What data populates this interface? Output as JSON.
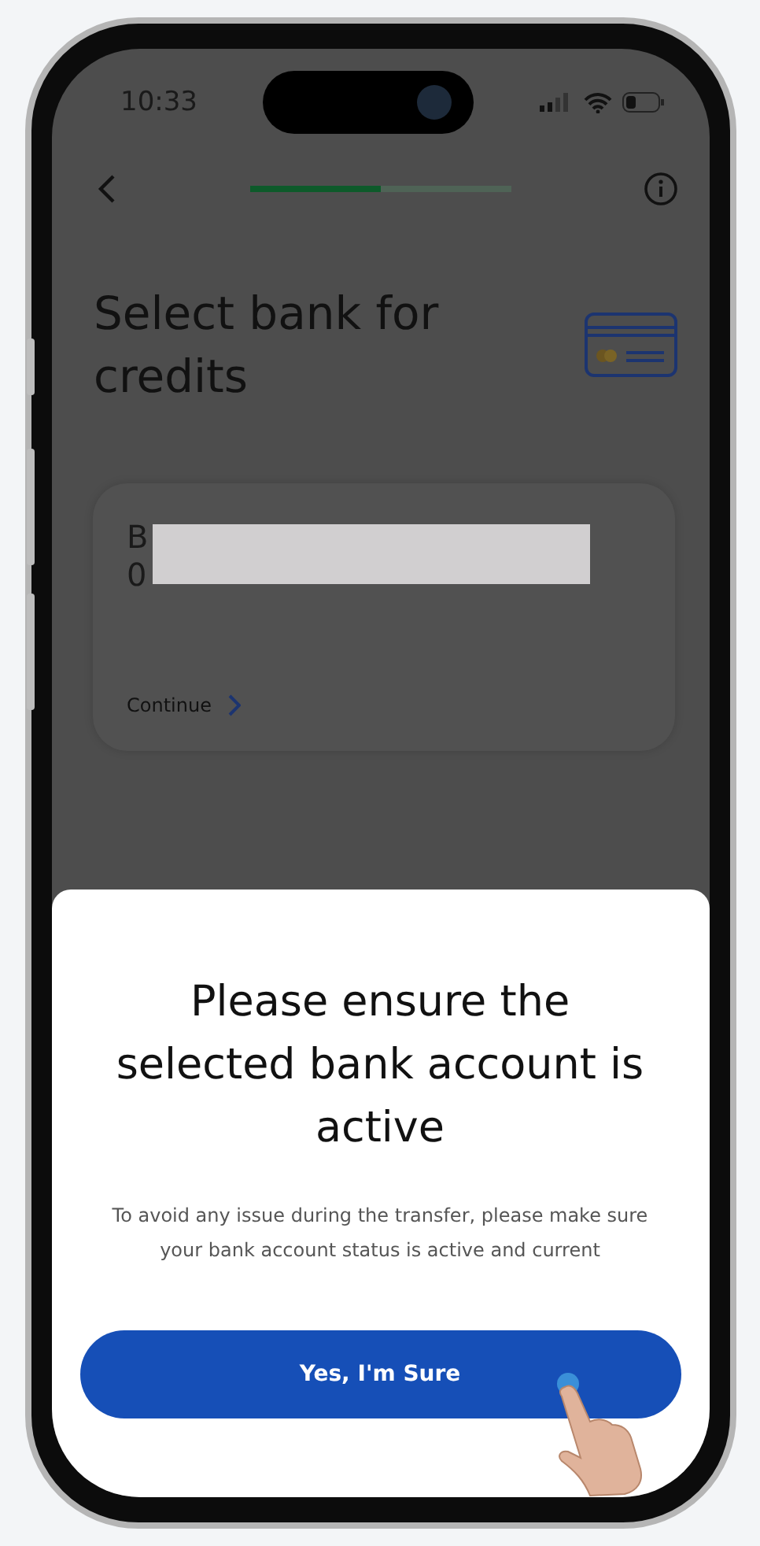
{
  "status_bar": {
    "time": "10:33"
  },
  "header": {
    "progress": {
      "level": 0.5
    }
  },
  "title": "Select bank for credits",
  "bank_card": {
    "name_visible": "B",
    "number_visible": "0",
    "action": "Continue"
  },
  "dialog": {
    "title": "Please ensure the selected bank account is active",
    "message": "To avoid any issue during the transfer, please make sure your bank account status is active and current",
    "button": "Yes, I'm Sure"
  }
}
